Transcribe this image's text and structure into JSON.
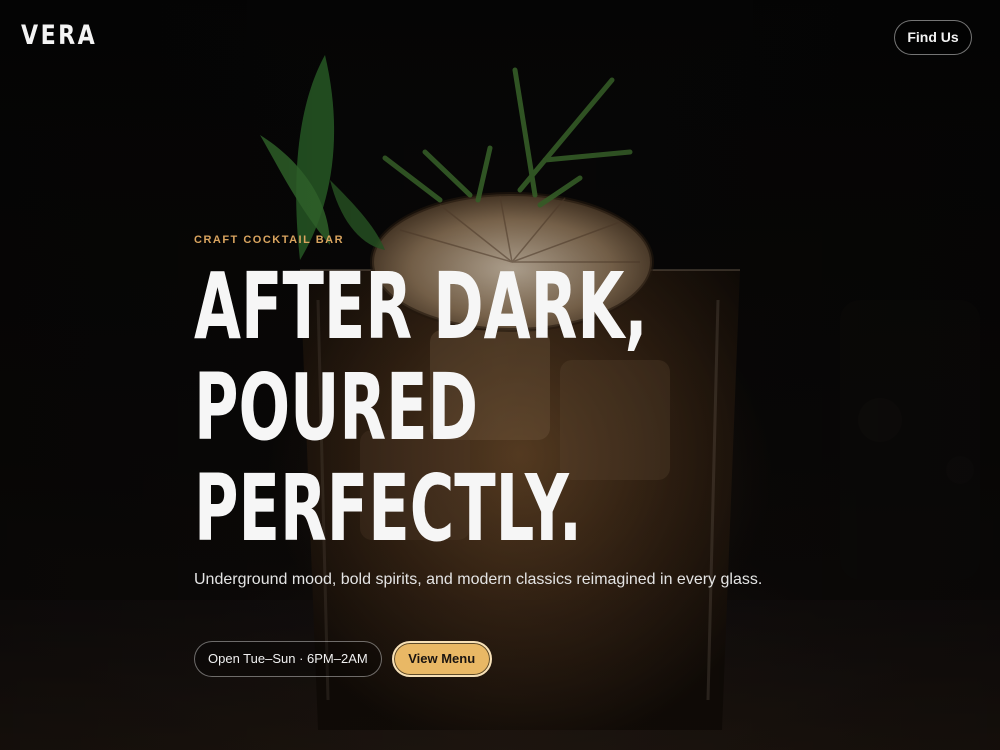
{
  "brand": {
    "logo_text": "VERA"
  },
  "nav": {
    "find_us_label": "Find Us"
  },
  "hero": {
    "eyebrow": "CRAFT COCKTAIL BAR",
    "headline_lines": [
      "AFTER DARK,",
      "POURED",
      "PERFECTLY."
    ],
    "subtitle": "Underground mood, bold spirits, and modern classics reimagined in every glass.",
    "hours_label": "Open Tue–Sun · 6PM–2AM",
    "menu_button_label": "View Menu"
  },
  "colors": {
    "background": "#050505",
    "accent": "#e9b865",
    "eyebrow": "#d9a45f",
    "text": "#f6f6f6"
  },
  "background_image": {
    "subject": "cocktail-glass-with-herb-garnish"
  }
}
